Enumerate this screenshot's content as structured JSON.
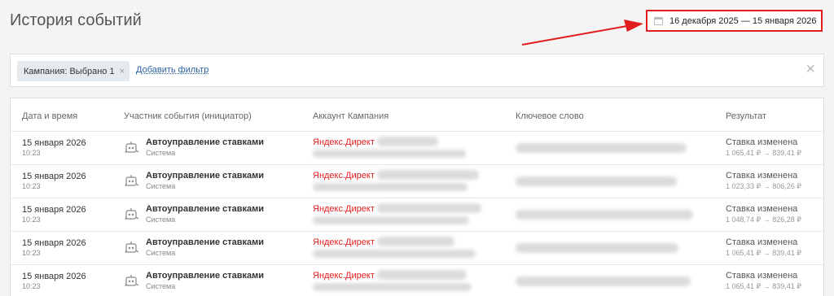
{
  "page_title": "История событий",
  "date_range": "16 декабря 2025 — 15 января 2026",
  "filters": {
    "chip_label": "Кампания: Выбрано 1",
    "chip_remove": "×",
    "add_filter": "Добавить фильтр",
    "clear": "×"
  },
  "table": {
    "headers": [
      "Дата и время",
      "Участник события (инициатор)",
      "Аккаунт Кампания",
      "Ключевое слово",
      "Результат"
    ],
    "rows": [
      {
        "date": "15 января 2026",
        "time": "10:23",
        "actor": "Автоуправление ставками",
        "role": "Система",
        "account": "Яндекс.Директ",
        "result": "Ставка изменена",
        "bid": "1 065,41 ₽ → 839,41 ₽"
      },
      {
        "date": "15 января 2026",
        "time": "10:23",
        "actor": "Автоуправление ставками",
        "role": "Система",
        "account": "Яндекс.Директ",
        "result": "Ставка изменена",
        "bid": "1 023,33 ₽ → 806,26 ₽"
      },
      {
        "date": "15 января 2026",
        "time": "10:23",
        "actor": "Автоуправление ставками",
        "role": "Система",
        "account": "Яндекс.Директ",
        "result": "Ставка изменена",
        "bid": "1 048,74 ₽ → 826,28 ₽"
      },
      {
        "date": "15 января 2026",
        "time": "10:23",
        "actor": "Автоуправление ставками",
        "role": "Система",
        "account": "Яндекс.Директ",
        "result": "Ставка изменена",
        "bid": "1 065,41 ₽ → 839,41 ₽"
      },
      {
        "date": "15 января 2026",
        "time": "10:23",
        "actor": "Автоуправление ставками",
        "role": "Система",
        "account": "Яндекс.Директ",
        "result": "Ставка изменена",
        "bid": "1 065,41 ₽ → 839,41 ₽"
      }
    ]
  },
  "colors": {
    "accent_red": "#e21d1d",
    "link_blue": "#2b5f9e"
  },
  "icons": {
    "date": "calendar-icon",
    "actor": "robot-icon",
    "clear": "close-icon"
  }
}
